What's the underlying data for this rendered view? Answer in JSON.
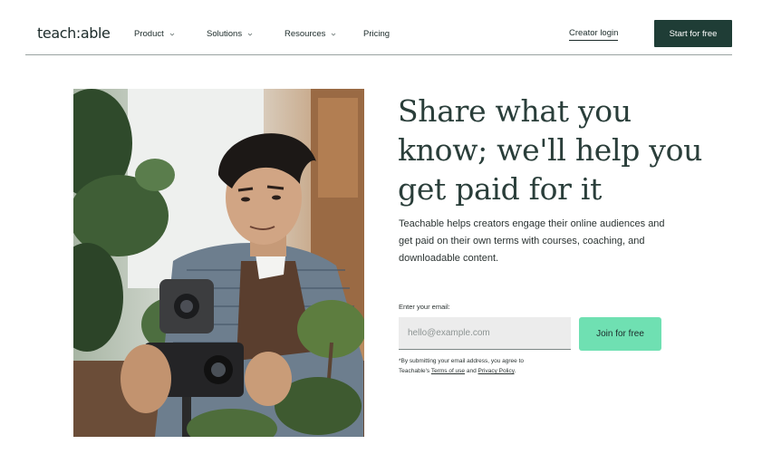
{
  "nav": {
    "logo": "teach:able",
    "items": [
      {
        "label": "Product"
      },
      {
        "label": "Solutions"
      },
      {
        "label": "Resources"
      },
      {
        "label": "Pricing"
      }
    ],
    "creator_login": "Creator login",
    "start_cta": "Start for free"
  },
  "hero": {
    "headline_lines": [
      "Share what you",
      "know; we'll help you",
      "get paid for it"
    ],
    "description_lines": [
      "Teachable helps creators engage their online audiences and",
      "get paid on their own terms with courses, coaching, and",
      "downloadable content."
    ],
    "email_label": "Enter your email:",
    "email_placeholder": "hello@example.com",
    "email_value": "",
    "join_button": "Join for free",
    "legal_line1": "*By submitting your email address, you agree to",
    "legal_prefix": "Teachable's",
    "terms_link": "Terms of use",
    "legal_and": "and",
    "privacy_link": "Privacy Policy",
    "legal_suffix": "."
  },
  "colors": {
    "brand_dark": "#1f3d36",
    "accent_mint": "#6fe0b2",
    "text_dark": "#1c2b2a"
  },
  "icons": {
    "chevron": "chevron-down-icon"
  }
}
